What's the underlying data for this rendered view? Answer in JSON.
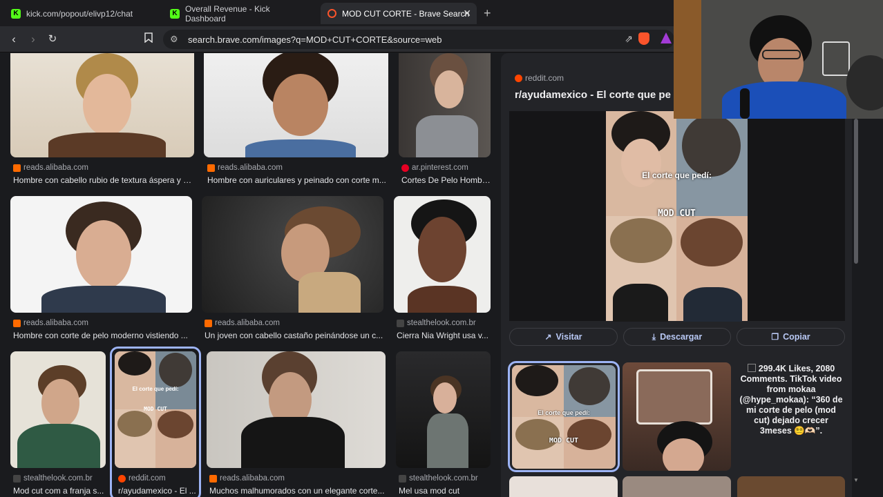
{
  "tabs": [
    {
      "label": "kick.com/popout/elivp12/chat",
      "favicon": "kick-icon"
    },
    {
      "label": "Overall Revenue - Kick Dashboard",
      "favicon": "kick-icon"
    },
    {
      "label": "MOD CUT CORTE - Brave Search",
      "favicon": "brave-icon",
      "active": true
    }
  ],
  "url": "search.brave.com/images?q=MOD+CUT+CORTE&source=web",
  "results": [
    {
      "source": "reads.alibaba.com",
      "title": "Hombre con cabello rubio de textura áspera y c..."
    },
    {
      "source": "reads.alibaba.com",
      "title": "Hombre con auriculares y peinado con corte m..."
    },
    {
      "source": "ar.pinterest.com",
      "title": "Cortes De Pelo Hombr..."
    },
    {
      "source": "reads.alibaba.com",
      "title": "Hombre con corte de pelo moderno vistiendo ..."
    },
    {
      "source": "reads.alibaba.com",
      "title": "Un joven con cabello castaño peinándose un c..."
    },
    {
      "source": "stealthelook.com.br",
      "title": "Cierra Nia Wright usa v..."
    },
    {
      "source": "stealthelook.com.br",
      "title": "Mod cut com a franja s..."
    },
    {
      "source": "reddit.com",
      "title": "r/ayudamexico - El ..."
    },
    {
      "source": "reads.alibaba.com",
      "title": "Muchos malhumorados con un elegante corte..."
    },
    {
      "source": "stealthelook.com.br",
      "title": "Mel usa mod cut"
    }
  ],
  "panel": {
    "source": "reddit.com",
    "title": "r/ayudamexico - El corte que pe",
    "image_caption": "El corte que pedí:",
    "image_label": "MOD CUT",
    "buttons": {
      "visit": "Visitar",
      "download": "Descargar",
      "copy": "Copiar"
    },
    "related_alt": "299.4K Likes, 2080 Comments. TikTok video from mokaa (@hype_mokaa): “360 de mi corte de pelo (mod cut) dejado crecer 3meses 😵‍💫🫶🏻”.",
    "related_caption": "El corte que pedí:",
    "related_label": "MOD CUT"
  },
  "colors": {
    "accent": "#9db4f5",
    "alibaba": "#ff6a00",
    "reddit": "#ff4500",
    "pinterest": "#e60023",
    "kick": "#53fc18"
  }
}
